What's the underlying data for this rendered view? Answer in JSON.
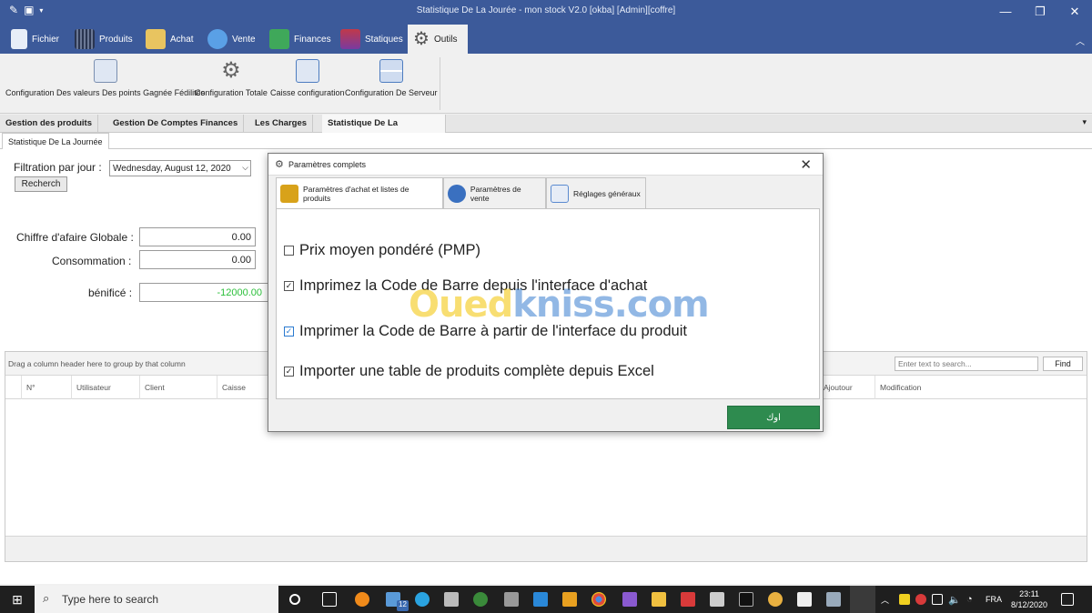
{
  "window": {
    "title": "Statistique De La Jourée - mon stock V2.0 [okba] [Admin][coffre]"
  },
  "ribbon": {
    "tabs": [
      {
        "label": "Fichier",
        "icon": "file-icon",
        "color": "#e8eef8"
      },
      {
        "label": "Produits",
        "icon": "barcode-icon",
        "color": "#44506a"
      },
      {
        "label": "Achat",
        "icon": "cart-icon",
        "color": "#e8c460"
      },
      {
        "label": "Vente",
        "icon": "sale-tag-icon",
        "color": "#5aa0e6"
      },
      {
        "label": "Finances",
        "icon": "money-icon",
        "color": "#3fa85a"
      },
      {
        "label": "Statiques",
        "icon": "chart-icon",
        "color": "#c0394a"
      },
      {
        "label": "Outils",
        "icon": "gears-icon",
        "color": "#555555"
      }
    ],
    "buttons": [
      {
        "label": "Configuration Des valeurs Des points Gagnée Fédilités",
        "icon": "loyalty-settings-icon"
      },
      {
        "label": "Configuration Totale",
        "icon": "gear-icon"
      },
      {
        "label": "Caisse configuration",
        "icon": "cash-register-icon"
      },
      {
        "label": "Configuration De Serveur",
        "icon": "server-icon"
      }
    ]
  },
  "doc_tabs": [
    "Gestion des produits",
    "Gestion De Comptes Finances",
    "Les Charges",
    "Statistique De La Jourée"
  ],
  "sub_tab": "Statistique De La Journée",
  "filter": {
    "label": "Filtration par jour :",
    "date_value": "Wednesday,     August     12, 2020",
    "search_button": "Recherch"
  },
  "stats": {
    "chiffre_label": "Chiffre d'afaire Globale :",
    "chiffre_value": "0.00",
    "consommation_label": "Consommation :",
    "consommation_value": "0.00",
    "benefice_label": "bénificé :",
    "benefice_value": "-12000.00"
  },
  "grid": {
    "group_hint": "Drag a column header here to group by that column",
    "search_placeholder": "Enter text to search...",
    "find_button": "Find",
    "columns": [
      "N°",
      "Utilisateur",
      "Client",
      "Caisse",
      "Ajoutour",
      "Modification"
    ]
  },
  "dialog": {
    "title": "Paramètres complets",
    "tabs": [
      {
        "label": "Paramètres d'achat et listes de produits",
        "icon": "purchase-settings-icon",
        "color": "#d8a21a"
      },
      {
        "label": "Paramètres de vente",
        "icon": "sale-settings-icon",
        "color": "#3a70c0"
      },
      {
        "label": "Réglages généraux",
        "icon": "general-settings-icon",
        "color": "#5a8ad0"
      }
    ],
    "options": [
      {
        "label": "Prix moyen pondéré (PMP)",
        "checked": false
      },
      {
        "label": "Imprimez la Code de Barre depuis l'interface d'achat",
        "checked": true
      },
      {
        "label": "Imprimer la Code de Barre à partir de l'interface du produit",
        "checked": true
      },
      {
        "label": "Importer une table de produits complète depuis Excel",
        "checked": true
      }
    ],
    "ok_button": "اوك"
  },
  "watermark": {
    "part1": "Oued",
    "part2": "kniss",
    "part3": ".com"
  },
  "taskbar": {
    "search_placeholder": "Type here to search",
    "mail_badge": "12",
    "language": "FRA",
    "time": "23:11",
    "date": "8/12/2020"
  }
}
